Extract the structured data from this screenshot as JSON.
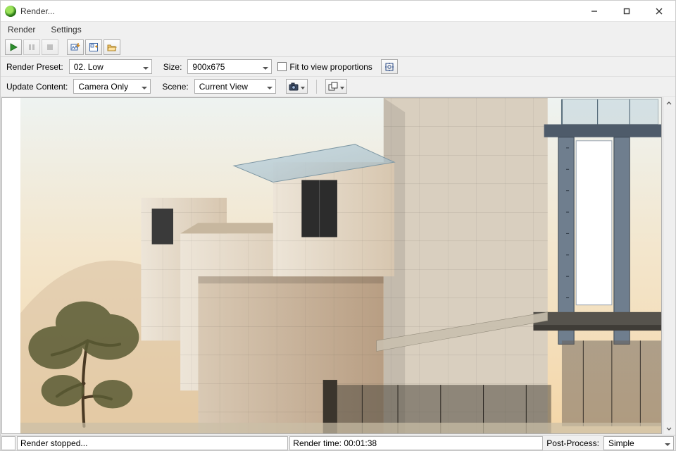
{
  "window": {
    "title": "Render..."
  },
  "menu": {
    "render": "Render",
    "settings": "Settings"
  },
  "options": {
    "render_preset_label": "Render Preset:",
    "render_preset_value": "02. Low",
    "size_label": "Size:",
    "size_value": "900x675",
    "fit_label": "Fit to view proportions",
    "update_content_label": "Update Content:",
    "update_content_value": "Camera Only",
    "scene_label": "Scene:",
    "scene_value": "Current View"
  },
  "status": {
    "message": "Render stopped...",
    "render_time": "Render time: 00:01:38",
    "post_process_label": "Post-Process:",
    "post_process_value": "Simple"
  }
}
